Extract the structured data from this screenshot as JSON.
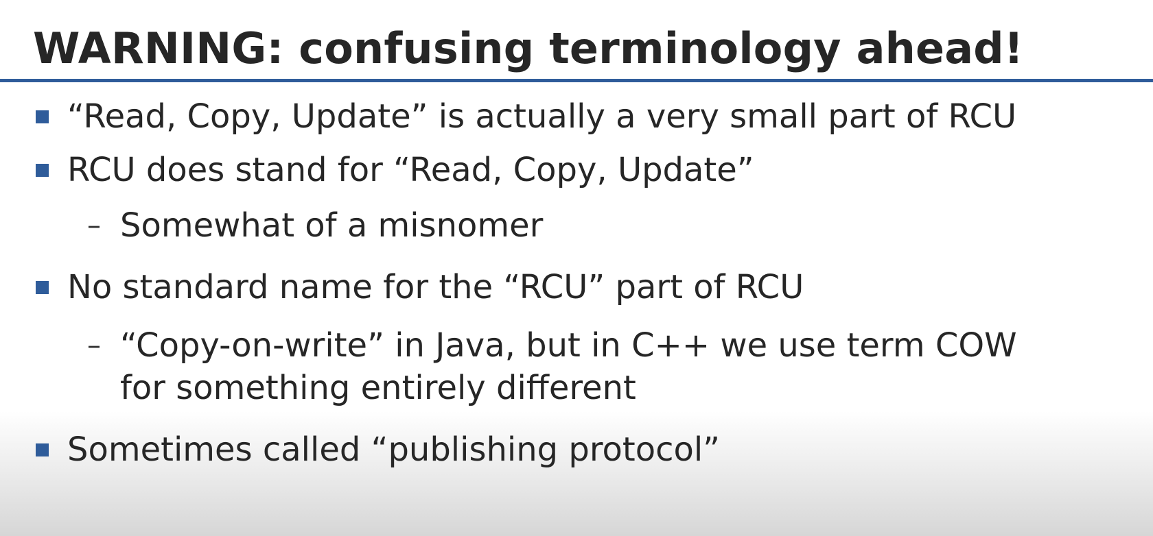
{
  "slide": {
    "title": "WARNING: confusing terminology ahead!",
    "colors": {
      "accent": "#2f5c9a",
      "text": "#262626"
    },
    "items": [
      {
        "level": 1,
        "text": "“Read, Copy, Update” is actually a very small part of RCU"
      },
      {
        "level": 1,
        "text": "RCU does stand for “Read, Copy, Update”"
      },
      {
        "level": 2,
        "text": "Somewhat of a misnomer"
      },
      {
        "level": 1,
        "text": "No standard name for the “RCU” part of RCU"
      },
      {
        "level": 2,
        "text": "“Copy-on-write” in Java, but in C++ we use term COW"
      },
      {
        "level": 2,
        "text": "for something entirely different",
        "continuation": true
      },
      {
        "level": 1,
        "text": "Sometimes called “publishing protocol”"
      }
    ],
    "icons": {
      "bullet": "square-bullet-icon",
      "sub_bullet": "dash-bullet-icon"
    }
  }
}
